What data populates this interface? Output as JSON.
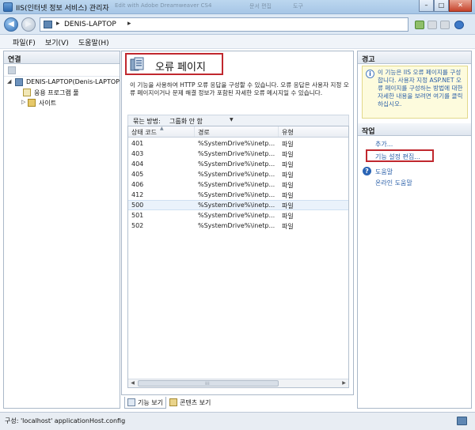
{
  "window": {
    "title": "IIS(인터넷 정보 서비스) 관리자",
    "background_tabs": [
      "Edit with Adobe Dreamweaver CS4",
      "문서 편집",
      "도구"
    ],
    "controls": {
      "minimize": "–",
      "maximize": "□",
      "close": "✕"
    }
  },
  "address_bar": {
    "back": "back-arrow-icon",
    "forward": "forward-arrow-icon",
    "separator": "▸",
    "path": "DENIS-LAPTOP",
    "path_arrow": "▸"
  },
  "menu": {
    "items": [
      "파일(F)",
      "보기(V)",
      "도움말(H)"
    ]
  },
  "left_pane": {
    "title": "연결",
    "tree": {
      "root": "DENIS-LAPTOP(Denis-LAPTOP",
      "children": [
        "응용 프로그램 풀",
        "사이트"
      ]
    }
  },
  "main": {
    "title": "오류 페이지",
    "description": "이 기능을 사용하여 HTTP 오류 응답을 구성할 수 있습니다. 오류 응답은 사용자 지정 오류 페이지이거나 문제 해결 정보가 포함된 자세한 오류 메시지일 수 있습니다.",
    "group_by_label": "묶는 방법:",
    "group_by_value": "그룹화 안 함",
    "columns": [
      "상태 코드",
      "경로",
      "유형"
    ],
    "rows": [
      {
        "code": "401",
        "path": "%SystemDrive%\\inetp...",
        "type": "파일"
      },
      {
        "code": "403",
        "path": "%SystemDrive%\\inetp...",
        "type": "파일"
      },
      {
        "code": "404",
        "path": "%SystemDrive%\\inetp...",
        "type": "파일"
      },
      {
        "code": "405",
        "path": "%SystemDrive%\\inetp...",
        "type": "파일"
      },
      {
        "code": "406",
        "path": "%SystemDrive%\\inetp...",
        "type": "파일"
      },
      {
        "code": "412",
        "path": "%SystemDrive%\\inetp...",
        "type": "파일"
      },
      {
        "code": "500",
        "path": "%SystemDrive%\\inetp...",
        "type": "파일"
      },
      {
        "code": "501",
        "path": "%SystemDrive%\\inetp...",
        "type": "파일"
      },
      {
        "code": "502",
        "path": "%SystemDrive%\\inetp...",
        "type": "파일"
      }
    ],
    "selected_row": "500",
    "view_tabs": [
      "기능 보기",
      "콘텐츠 보기"
    ]
  },
  "right_pane": {
    "alerts_title": "경고",
    "alert_text": "이 기능은 IIS 오류 페이지를 구성합니다. 사용자 지정 ASP.NET 오류 페이지를 구성하는 방법에 대한 자세한 내용을 보려면 여기를 클릭하십시오.",
    "actions_title": "작업",
    "actions": [
      "추가...",
      "기능 설정 편집...",
      "도움말",
      "온라인 도움말"
    ]
  },
  "status_bar": {
    "text": "구성: 'localhost' applicationHost.config"
  },
  "colors": {
    "highlight_border": "#c0282e",
    "link": "#2a5fa8",
    "alert_bg": "#fdfbdd",
    "selected_row": "#eaf2fb"
  }
}
